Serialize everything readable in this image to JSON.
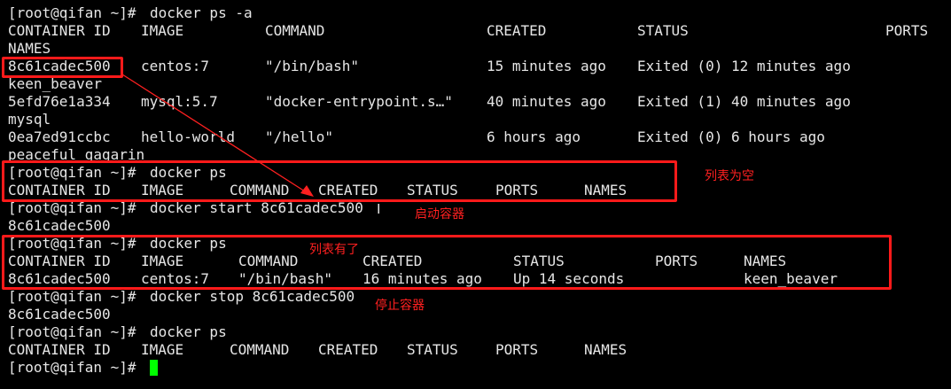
{
  "prompt": "[root@qifan ~]# ",
  "block1": {
    "command": "docker ps -a",
    "headers": [
      "CONTAINER ID",
      "IMAGE",
      "COMMAND",
      "CREATED",
      "STATUS",
      "PORTS"
    ],
    "header_wrap": "NAMES",
    "rows": [
      {
        "id": "8c61cadec500",
        "image": "centos:7",
        "command": "\"/bin/bash\"",
        "created": "15 minutes ago",
        "status": "Exited (0) 12 minutes ago",
        "name": "keen_beaver"
      },
      {
        "id": "5efd76e1a334",
        "image": "mysql:5.7",
        "command": "\"docker-entrypoint.s…\"",
        "created": "40 minutes ago",
        "status": "Exited (1) 40 minutes ago",
        "name": "mysql"
      },
      {
        "id": "0ea7ed91ccbc",
        "image": "hello-world",
        "command": "\"/hello\"",
        "created": "6 hours ago",
        "status": "Exited (0) 6 hours ago",
        "name": "peaceful_gagarin"
      }
    ]
  },
  "block2": {
    "command": "docker ps",
    "headers": [
      "CONTAINER ID",
      "IMAGE",
      "COMMAND",
      "CREATED",
      "STATUS",
      "PORTS",
      "NAMES"
    ]
  },
  "block3": {
    "command": "docker start 8c61cadec500",
    "output": "8c61cadec500"
  },
  "block4": {
    "command": "docker ps",
    "headers": [
      "CONTAINER ID",
      "IMAGE",
      "COMMAND",
      "CREATED",
      "STATUS",
      "PORTS",
      "NAMES"
    ],
    "row": {
      "id": "8c61cadec500",
      "image": "centos:7",
      "command": "\"/bin/bash\"",
      "created": "16 minutes ago",
      "status": "Up 14 seconds",
      "name": "keen_beaver"
    }
  },
  "block5": {
    "command": "docker stop 8c61cadec500",
    "output": "8c61cadec500"
  },
  "block6": {
    "command": "docker ps",
    "headers": [
      "CONTAINER ID",
      "IMAGE",
      "COMMAND",
      "CREATED",
      "STATUS",
      "PORTS",
      "NAMES"
    ]
  },
  "annotations": {
    "empty_list": "列表为空",
    "start_container": "启动容器",
    "list_has_items": "列表有了",
    "stop_container": "停止容器"
  },
  "colors": {
    "background": "#000000",
    "text": "#e6e6e6",
    "annotation": "#ff2020",
    "cursor": "#00ff00"
  }
}
